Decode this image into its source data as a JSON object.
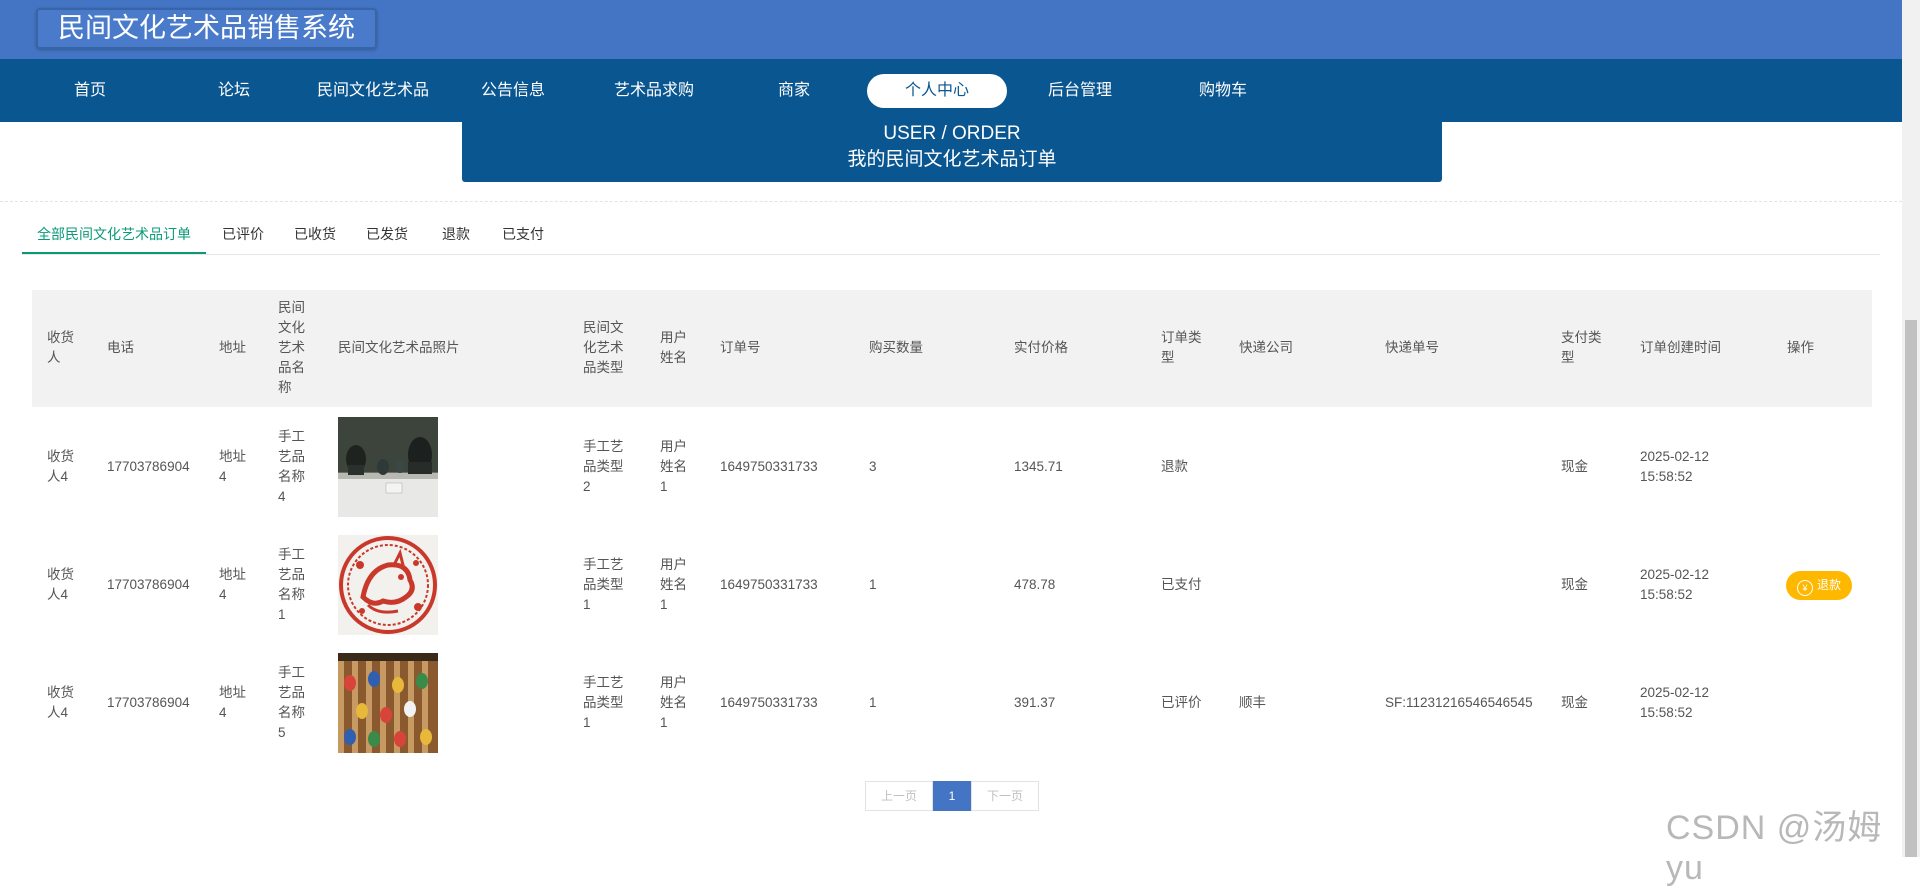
{
  "site": {
    "title": "民间文化艺术品销售系统"
  },
  "nav": {
    "items": [
      "首页",
      "论坛",
      "民间文化艺术品",
      "公告信息",
      "艺术品求购",
      "商家",
      "个人中心",
      "后台管理",
      "购物车"
    ],
    "active_index": 6
  },
  "banner": {
    "en": "USER / ORDER",
    "cn": "我的民间文化艺术品订单"
  },
  "tabs": {
    "items": [
      "全部民间文化艺术品订单",
      "已评价",
      "已收货",
      "已发货",
      "退款",
      "已支付"
    ],
    "active_index": 0
  },
  "table": {
    "headers": [
      "收货人",
      "电话",
      "地址",
      "民间文化艺术品名称",
      "民间文化艺术品照片",
      "民间文化艺术品类型",
      "用户姓名",
      "订单号",
      "购买数量",
      "实付价格",
      "订单类型",
      "快递公司",
      "快递单号",
      "支付类型",
      "订单创建时间",
      "操作"
    ],
    "rows": [
      {
        "receiver": "收货人4",
        "phone": "17703786904",
        "address": "地址4",
        "name": "手工艺品名称4",
        "photo": "photo-figurines",
        "type": "手工艺品类型2",
        "user": "用户姓名1",
        "order_no": "1649750331733",
        "qty": "3",
        "price": "1345.71",
        "order_type": "退款",
        "courier": "",
        "tracking": "",
        "pay_type": "现金",
        "created": "2025-02-12 15:58:52",
        "action": ""
      },
      {
        "receiver": "收货人4",
        "phone": "17703786904",
        "address": "地址4",
        "name": "手工艺品名称1",
        "photo": "photo-papercut",
        "type": "手工艺品类型1",
        "user": "用户姓名1",
        "order_no": "1649750331733",
        "qty": "1",
        "price": "478.78",
        "order_type": "已支付",
        "courier": "",
        "tracking": "",
        "pay_type": "现金",
        "created": "2025-02-12 15:58:52",
        "action": "退款"
      },
      {
        "receiver": "收货人4",
        "phone": "17703786904",
        "address": "地址4",
        "name": "手工艺品名称5",
        "photo": "photo-masks",
        "type": "手工艺品类型1",
        "user": "用户姓名1",
        "order_no": "1649750331733",
        "qty": "1",
        "price": "391.37",
        "order_type": "已评价",
        "courier": "顺丰",
        "tracking": "SF:11231216546546545",
        "pay_type": "现金",
        "created": "2025-02-12 15:58:52",
        "action": ""
      }
    ]
  },
  "pager": {
    "prev": "上一页",
    "current": "1",
    "next": "下一页"
  },
  "refund_icon": "yen-icon",
  "watermark": "CSDN @汤姆yu",
  "colors": {
    "topbar": "#4475c4",
    "navbar": "#0a5690",
    "accent": "#0a9a78",
    "refund": "#ffb800"
  }
}
